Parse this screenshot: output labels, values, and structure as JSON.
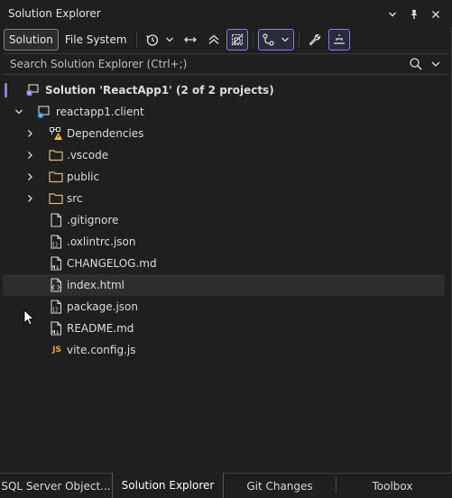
{
  "window": {
    "title": "Solution Explorer"
  },
  "toolbar": {
    "solution_label": "Solution",
    "filesystem_label": "File System"
  },
  "search": {
    "placeholder": "Search Solution Explorer (Ctrl+;)"
  },
  "tree": {
    "solution": "Solution 'ReactApp1' (2 of 2 projects)",
    "project": "reactapp1.client",
    "items": [
      {
        "label": "Dependencies",
        "kind": "dependencies"
      },
      {
        "label": ".vscode",
        "kind": "folder"
      },
      {
        "label": "public",
        "kind": "folder"
      },
      {
        "label": "src",
        "kind": "folder"
      },
      {
        "label": ".gitignore",
        "kind": "file"
      },
      {
        "label": ".oxlintrc.json",
        "kind": "json"
      },
      {
        "label": "CHANGELOG.md",
        "kind": "md"
      },
      {
        "label": "index.html",
        "kind": "html"
      },
      {
        "label": "package.json",
        "kind": "json"
      },
      {
        "label": "README.md",
        "kind": "md"
      },
      {
        "label": "vite.config.js",
        "kind": "js"
      }
    ],
    "js_badge": "JS"
  },
  "tabs": [
    {
      "label": "SQL Server Object..."
    },
    {
      "label": "Solution Explorer"
    },
    {
      "label": "Git Changes"
    },
    {
      "label": "Toolbox"
    }
  ],
  "colors": {
    "accent": "#8b7fd9",
    "folder": "#dcb67a",
    "js": "#e8a33d"
  }
}
